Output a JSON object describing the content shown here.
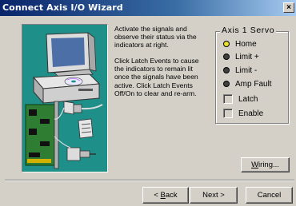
{
  "window": {
    "title": "Connect Axis I/O Wizard",
    "close_glyph": "×"
  },
  "description": {
    "para1": "Activate the signals and\nobserve their status via the\nindicators at right.",
    "para2": "Click Latch Events to cause\nthe indicators to remain lit\nonce the signals have been\nactive. Click Latch Events\nOff/On to clear and re-arm."
  },
  "group": {
    "title": "Axis 1 Servo",
    "indicators": [
      {
        "label": "Home",
        "color": "#e8e02a"
      },
      {
        "label": "Limit +",
        "color": "#404040"
      },
      {
        "label": "Limit -",
        "color": "#404040"
      },
      {
        "label": "Amp Fault",
        "color": "#404040"
      }
    ],
    "checkboxes": [
      {
        "label": "Latch",
        "checked": false
      },
      {
        "label": "Enable",
        "checked": false
      }
    ]
  },
  "buttons": {
    "wiring": {
      "mnemonic": "W",
      "rest": "iring..."
    },
    "back": {
      "prefix": "< ",
      "mnemonic": "B",
      "rest": "ack"
    },
    "next": "Next >",
    "cancel": "Cancel"
  },
  "colors": {
    "illustration_bg": "#1f8f8a",
    "title_bar": "#0a246a"
  }
}
